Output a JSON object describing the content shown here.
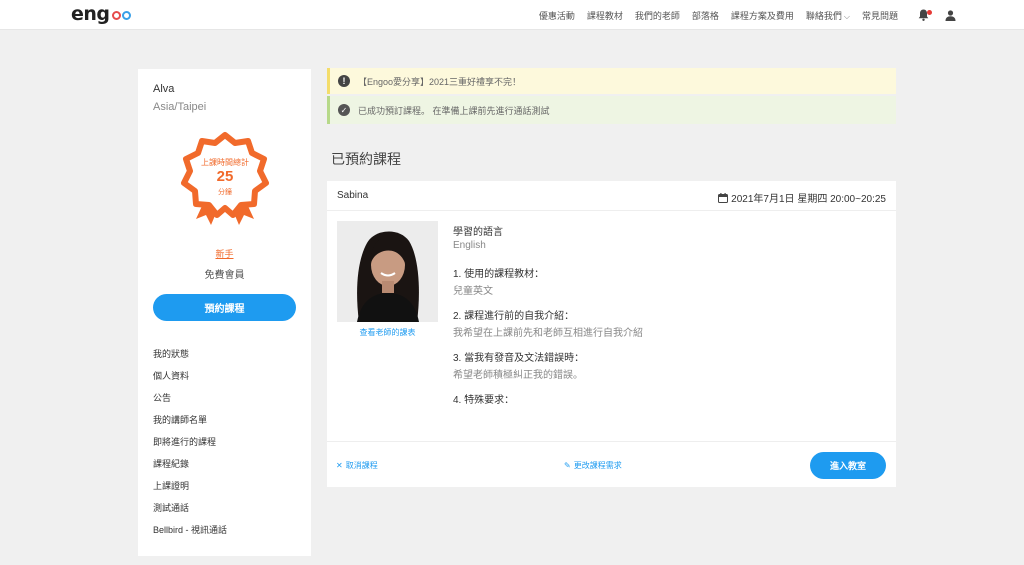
{
  "brand": {
    "logo_text": "eng",
    "accent": "#1e9bf0",
    "badge_color": "#f16a2b"
  },
  "nav": {
    "items": [
      "優惠活動",
      "課程教材",
      "我們的老師",
      "部落格",
      "課程方案及費用",
      "聯絡我們",
      "常見問題"
    ],
    "icons": [
      "bell-icon",
      "user-icon"
    ]
  },
  "sidebar": {
    "user_name": "Alva",
    "timezone": "Asia/Taipei",
    "badge": {
      "title": "上課時間總計",
      "minutes": "25",
      "unit": "分鐘"
    },
    "level": "新手",
    "membership": "免費會員",
    "book_button": "預約課程",
    "menu": [
      "我的狀態",
      "個人資料",
      "公告",
      "我的講師名單",
      "即將進行的課程",
      "課程紀錄",
      "上課證明",
      "測試通話",
      "Bellbird - 視訊通話"
    ]
  },
  "alerts": {
    "warning": "【Engoo愛分享】2021三重好禮享不完！",
    "success": "已成功預訂課程。 在準備上課前先進行通話測試"
  },
  "main": {
    "section_title": "已預約課程",
    "lesson": {
      "teacher": "Sabina",
      "datetime": "2021年7月1日 星期四 20:00~20:25",
      "teacher_link": "查看老師的課表",
      "language_label": "學習的語言",
      "language_value": "English",
      "q1_label": "1. 使用的課程教材：",
      "q1_value": "兒童英文",
      "q2_label": "2. 課程進行前的自我介紹：",
      "q2_value": "我希望在上課前先和老師互相進行自我介紹",
      "q3_label": "3. 當我有發音及文法錯誤時：",
      "q3_value": "希望老師積極糾正我的錯誤。",
      "q4_label": "4. 特殊要求：",
      "cancel_label": "取消課程",
      "edit_label": "更改課程需求",
      "enter_label": "進入教室"
    }
  }
}
